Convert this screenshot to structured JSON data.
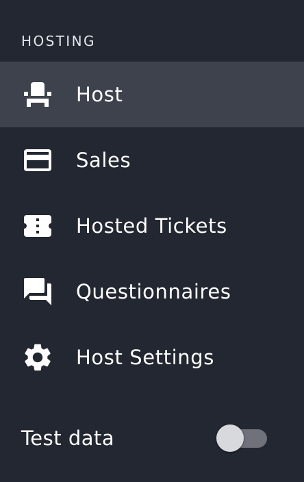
{
  "section": {
    "heading": "HOSTING"
  },
  "nav": {
    "items": [
      {
        "label": "Host",
        "icon": "seat-icon",
        "active": true
      },
      {
        "label": "Sales",
        "icon": "credit-card-icon",
        "active": false
      },
      {
        "label": "Hosted Tickets",
        "icon": "ticket-icon",
        "active": false
      },
      {
        "label": "Questionnaires",
        "icon": "forum-icon",
        "active": false
      },
      {
        "label": "Host Settings",
        "icon": "gear-icon",
        "active": false
      }
    ]
  },
  "footer": {
    "test_data_label": "Test data",
    "test_data_enabled": false
  },
  "colors": {
    "background": "#232731",
    "active_item": "#3d424c",
    "text": "#ffffff",
    "toggle_track": "#6f727a",
    "toggle_thumb": "#d8d9dc"
  }
}
